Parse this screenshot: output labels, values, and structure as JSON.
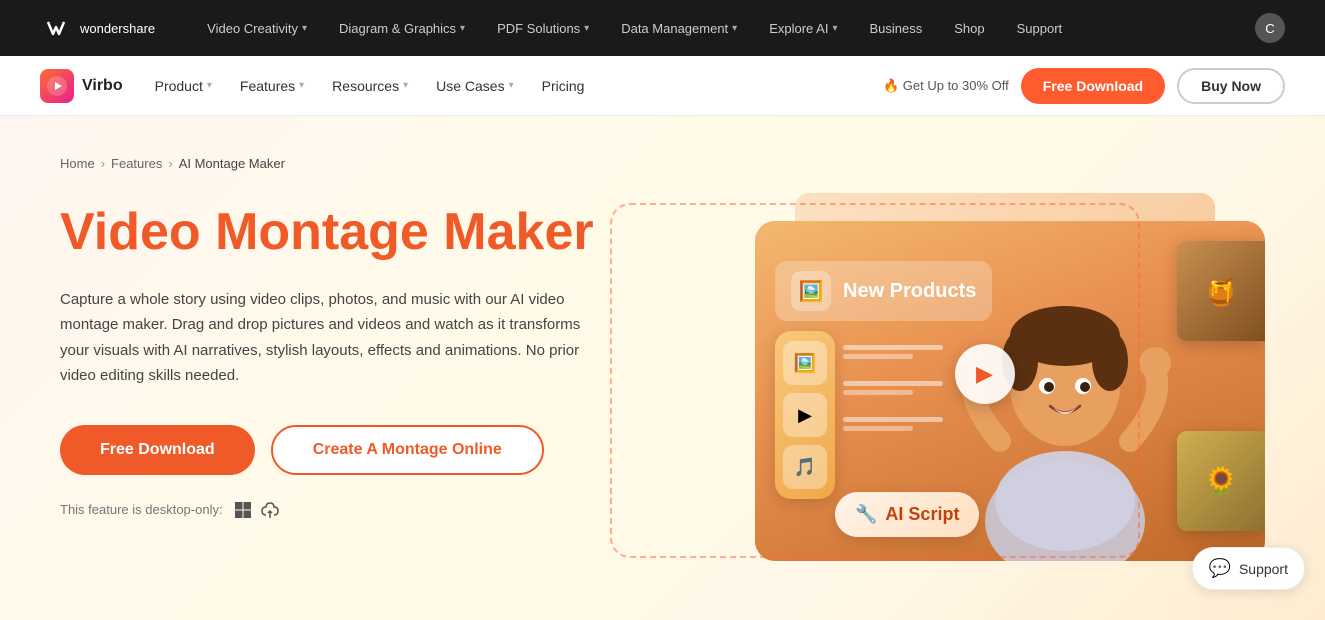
{
  "brand": {
    "name": "wondershare",
    "logo_text": "wondershare"
  },
  "top_nav": {
    "items": [
      {
        "label": "Video Creativity",
        "has_chevron": true
      },
      {
        "label": "Diagram & Graphics",
        "has_chevron": true
      },
      {
        "label": "PDF Solutions",
        "has_chevron": true
      },
      {
        "label": "Data Management",
        "has_chevron": true
      },
      {
        "label": "Explore AI",
        "has_chevron": true
      },
      {
        "label": "Business"
      },
      {
        "label": "Shop"
      },
      {
        "label": "Support"
      }
    ],
    "avatar_letter": "C"
  },
  "sub_nav": {
    "brand": "Virbo",
    "items": [
      {
        "label": "Product",
        "has_chevron": true
      },
      {
        "label": "Features",
        "has_chevron": true
      },
      {
        "label": "Resources",
        "has_chevron": true
      },
      {
        "label": "Use Cases",
        "has_chevron": true
      },
      {
        "label": "Pricing",
        "has_chevron": false
      }
    ],
    "promo": "🔥 Get Up to 30% Off",
    "btn_free": "Free Download",
    "btn_buy": "Buy Now"
  },
  "hero": {
    "breadcrumb": {
      "home": "Home",
      "features": "Features",
      "current": "AI Montage Maker"
    },
    "title": "Video Montage Maker",
    "description": "Capture a whole story using video clips, photos, and music with our AI video montage maker. Drag and drop pictures and videos and watch as it transforms your visuals with AI narratives, stylish layouts, effects and animations. No prior video editing skills needed.",
    "btn_download": "Free Download",
    "btn_online": "Create A Montage Online",
    "desktop_note": "This feature is desktop-only:",
    "illustration": {
      "new_products_label": "New Products",
      "play_label": "▶",
      "ai_script_label": "AI Script"
    }
  },
  "support": {
    "label": "Support"
  }
}
